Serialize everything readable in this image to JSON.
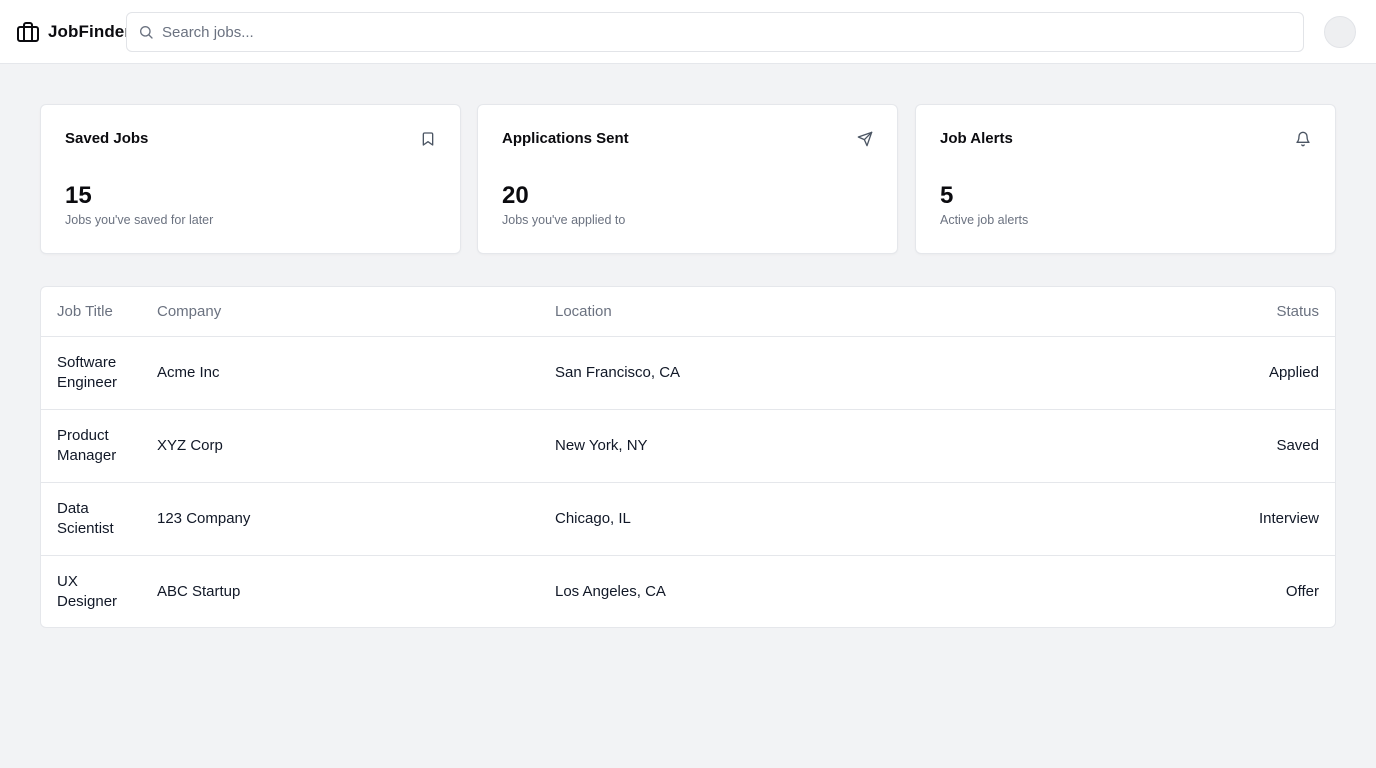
{
  "app": {
    "name": "JobFinder"
  },
  "header": {
    "search_placeholder": "Search jobs..."
  },
  "cards": [
    {
      "title": "Saved Jobs",
      "value": "15",
      "description": "Jobs you've saved for later",
      "icon": "bookmark-icon"
    },
    {
      "title": "Applications Sent",
      "value": "20",
      "description": "Jobs you've applied to",
      "icon": "send-icon"
    },
    {
      "title": "Job Alerts",
      "value": "5",
      "description": "Active job alerts",
      "icon": "bell-icon"
    }
  ],
  "table": {
    "headers": {
      "title": "Job Title",
      "company": "Company",
      "location": "Location",
      "status": "Status"
    },
    "rows": [
      {
        "title": "Software Engineer",
        "company": "Acme Inc",
        "location": "San Francisco, CA",
        "status": "Applied"
      },
      {
        "title": "Product Manager",
        "company": "XYZ Corp",
        "location": "New York, NY",
        "status": "Saved"
      },
      {
        "title": "Data Scientist",
        "company": "123 Company",
        "location": "Chicago, IL",
        "status": "Interview"
      },
      {
        "title": "UX Designer",
        "company": "ABC Startup",
        "location": "Los Angeles, CA",
        "status": "Offer"
      }
    ]
  }
}
